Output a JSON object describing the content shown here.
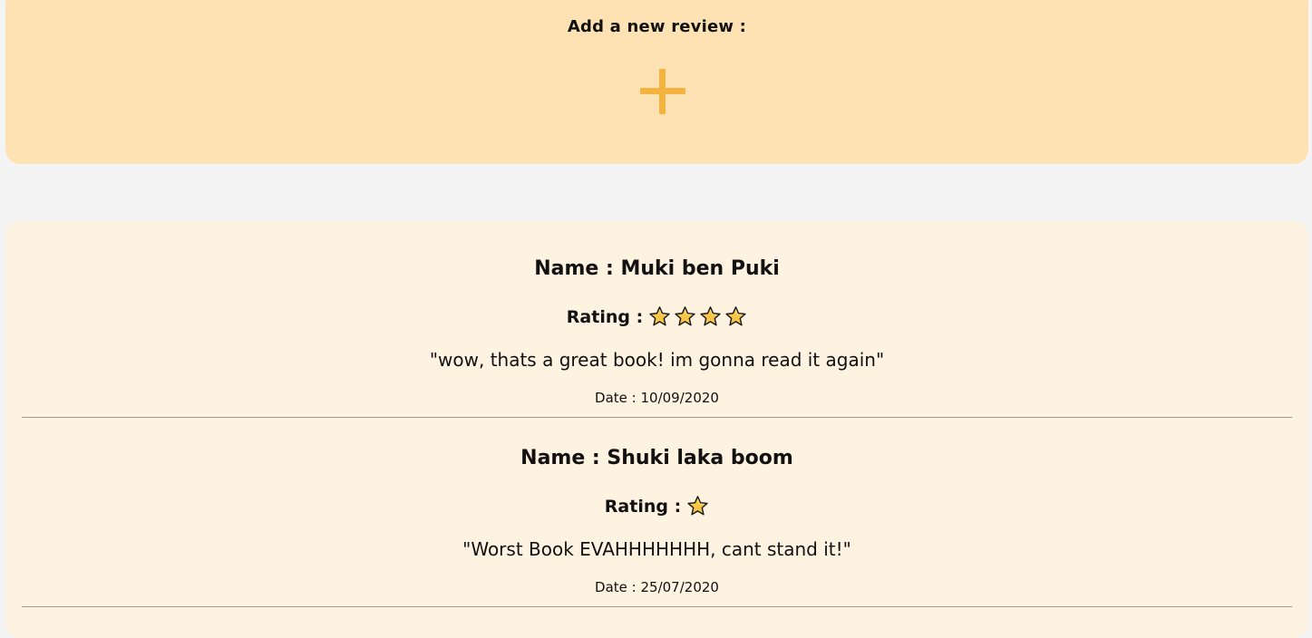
{
  "add_review": {
    "title": "Add a new review :",
    "add_button_icon": "plus-icon",
    "accent_color": "#f4b33f",
    "background_color": "#ffe2b3"
  },
  "reviews": [
    {
      "name_label": "Name : Muki ben Puki",
      "rating_label": "Rating :",
      "rating": 4,
      "text": "\"wow, thats a great book! im gonna read it again\"",
      "date_label": "Date : 10/09/2020"
    },
    {
      "name_label": "Name : Shuki laka boom",
      "rating_label": "Rating :",
      "rating": 1,
      "text": "\"Worst Book EVAHHHHHHH, cant stand it!\"",
      "date_label": "Date : 25/07/2020"
    }
  ],
  "star_icon": "star-icon",
  "star_color": "#f9c646",
  "reviews_background_color": "#fef2e1"
}
